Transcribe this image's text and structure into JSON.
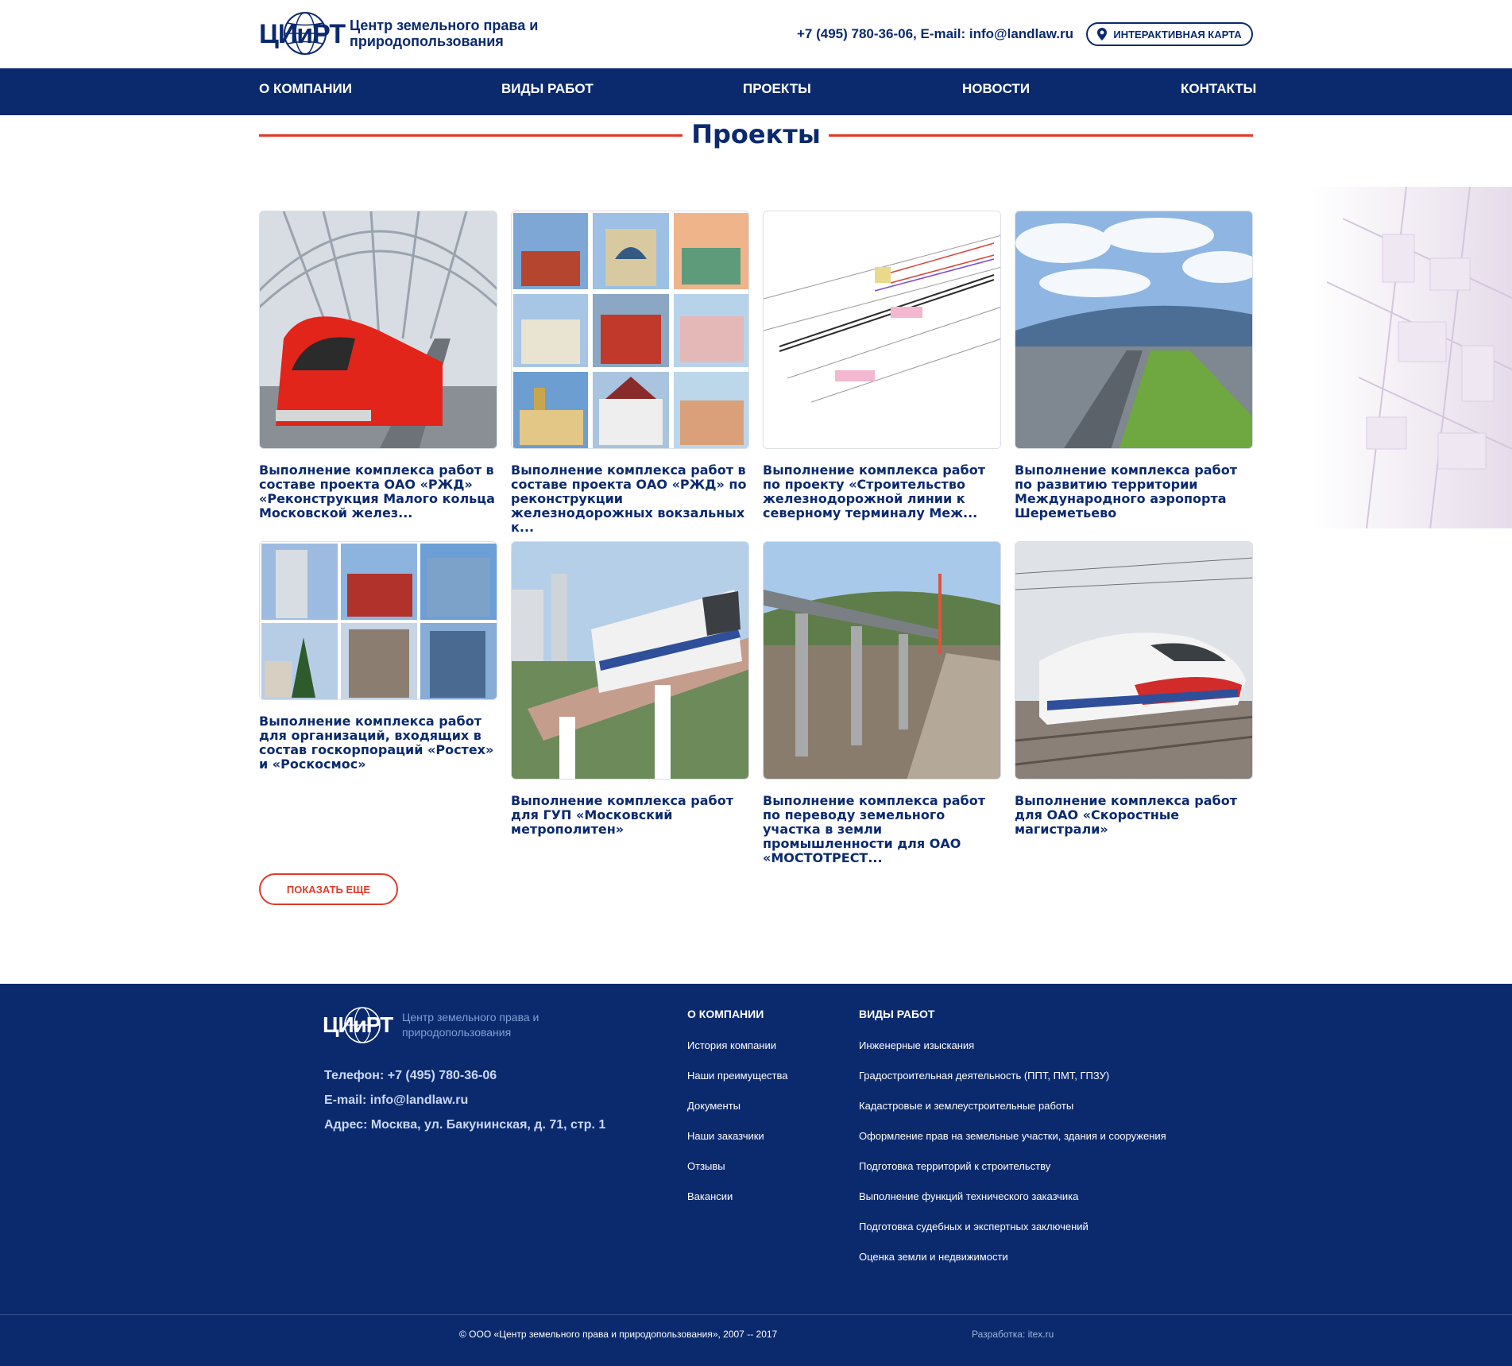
{
  "header": {
    "logo_mark": "ЦИиРТ",
    "logo_name": "Центр земельного права и природопользования",
    "contacts": "+7 (495) 780-36-06,  E-mail: info@landlaw.ru",
    "map_button": "ИНТЕРАКТИВНАЯ КАРТА"
  },
  "nav": {
    "items": [
      "О КОМПАНИИ",
      "ВИДЫ РАБОТ",
      "ПРОЕКТЫ",
      "НОВОСТИ",
      "КОНТАКТЫ"
    ]
  },
  "page": {
    "title": "Проекты",
    "more_button": "ПОКАЗАТЬ ЕЩЕ"
  },
  "projects": [
    {
      "title": "Выполнение комплекса работ в составе проекта ОАО «РЖД» «Реконструкция Малого кольца Московской желез...",
      "image": "red-train-under-glass-roof"
    },
    {
      "title": "Выполнение комплекса работ в составе проекта ОАО «РЖД» по реконструкции железнодорожных вокзальных к...",
      "image": "railway-stations-collage"
    },
    {
      "title": "Выполнение комплекса работ по проекту «Строительство железнодорожной линии к северному терминалу Меж...",
      "image": "railway-plan-drawing"
    },
    {
      "title": "Выполнение комплекса работ по развитию территории Международного аэропорта Шереметьево",
      "image": "airport-terminal"
    },
    {
      "title": "Выполнение комплекса работ для организаций, входящих в состав госкорпораций «Ростех» и «Роскосмос»",
      "image": "office-buildings-collage"
    },
    {
      "title": "Выполнение комплекса работ для ГУП «Московский метрополитен»",
      "image": "monorail-train"
    },
    {
      "title": "Выполнение комплекса работ по переводу земельного участка в земли промышленности для ОАО «МОСТОТРЕСТ...",
      "image": "bridge-construction"
    },
    {
      "title": "Выполнение комплекса работ для ОАО «Скоростные магистрали»",
      "image": "high-speed-train"
    }
  ],
  "footer": {
    "logo_mark": "ЦИиРТ",
    "logo_name": "Центр земельного права и природопользования",
    "phone": "Телефон: +7 (495) 780-36-06",
    "email": "E-mail: info@landlaw.ru",
    "address": "Адрес: Москва, ул. Бакунинская, д. 71, стр. 1",
    "company_heading": "О КОМПАНИИ",
    "company_links": [
      "История компании",
      "Наши преимущества",
      "Документы",
      "Наши заказчики",
      "Отзывы",
      "Вакансии"
    ],
    "works_heading": "ВИДЫ РАБОТ",
    "works_links": [
      "Инженерные изыскания",
      "Градостроительная деятельность (ППТ, ПМТ, ГПЗУ)",
      "Кадастровые и землеустроительные работы",
      "Оформление прав на земельные участки, здания и сооружения",
      "Подготовка территорий к строительству",
      "Выполнение функций технического заказчика",
      "Подготовка судебных и экспертных заключений",
      "Оценка земли и недвижимости"
    ],
    "copyright": "© ООО «Центр земельного права и природопользования», 2007 -- 2017",
    "developer": "Разработка: itex.ru"
  },
  "colors": {
    "brand": "#0b2a6e",
    "accent": "#e03a2a"
  }
}
